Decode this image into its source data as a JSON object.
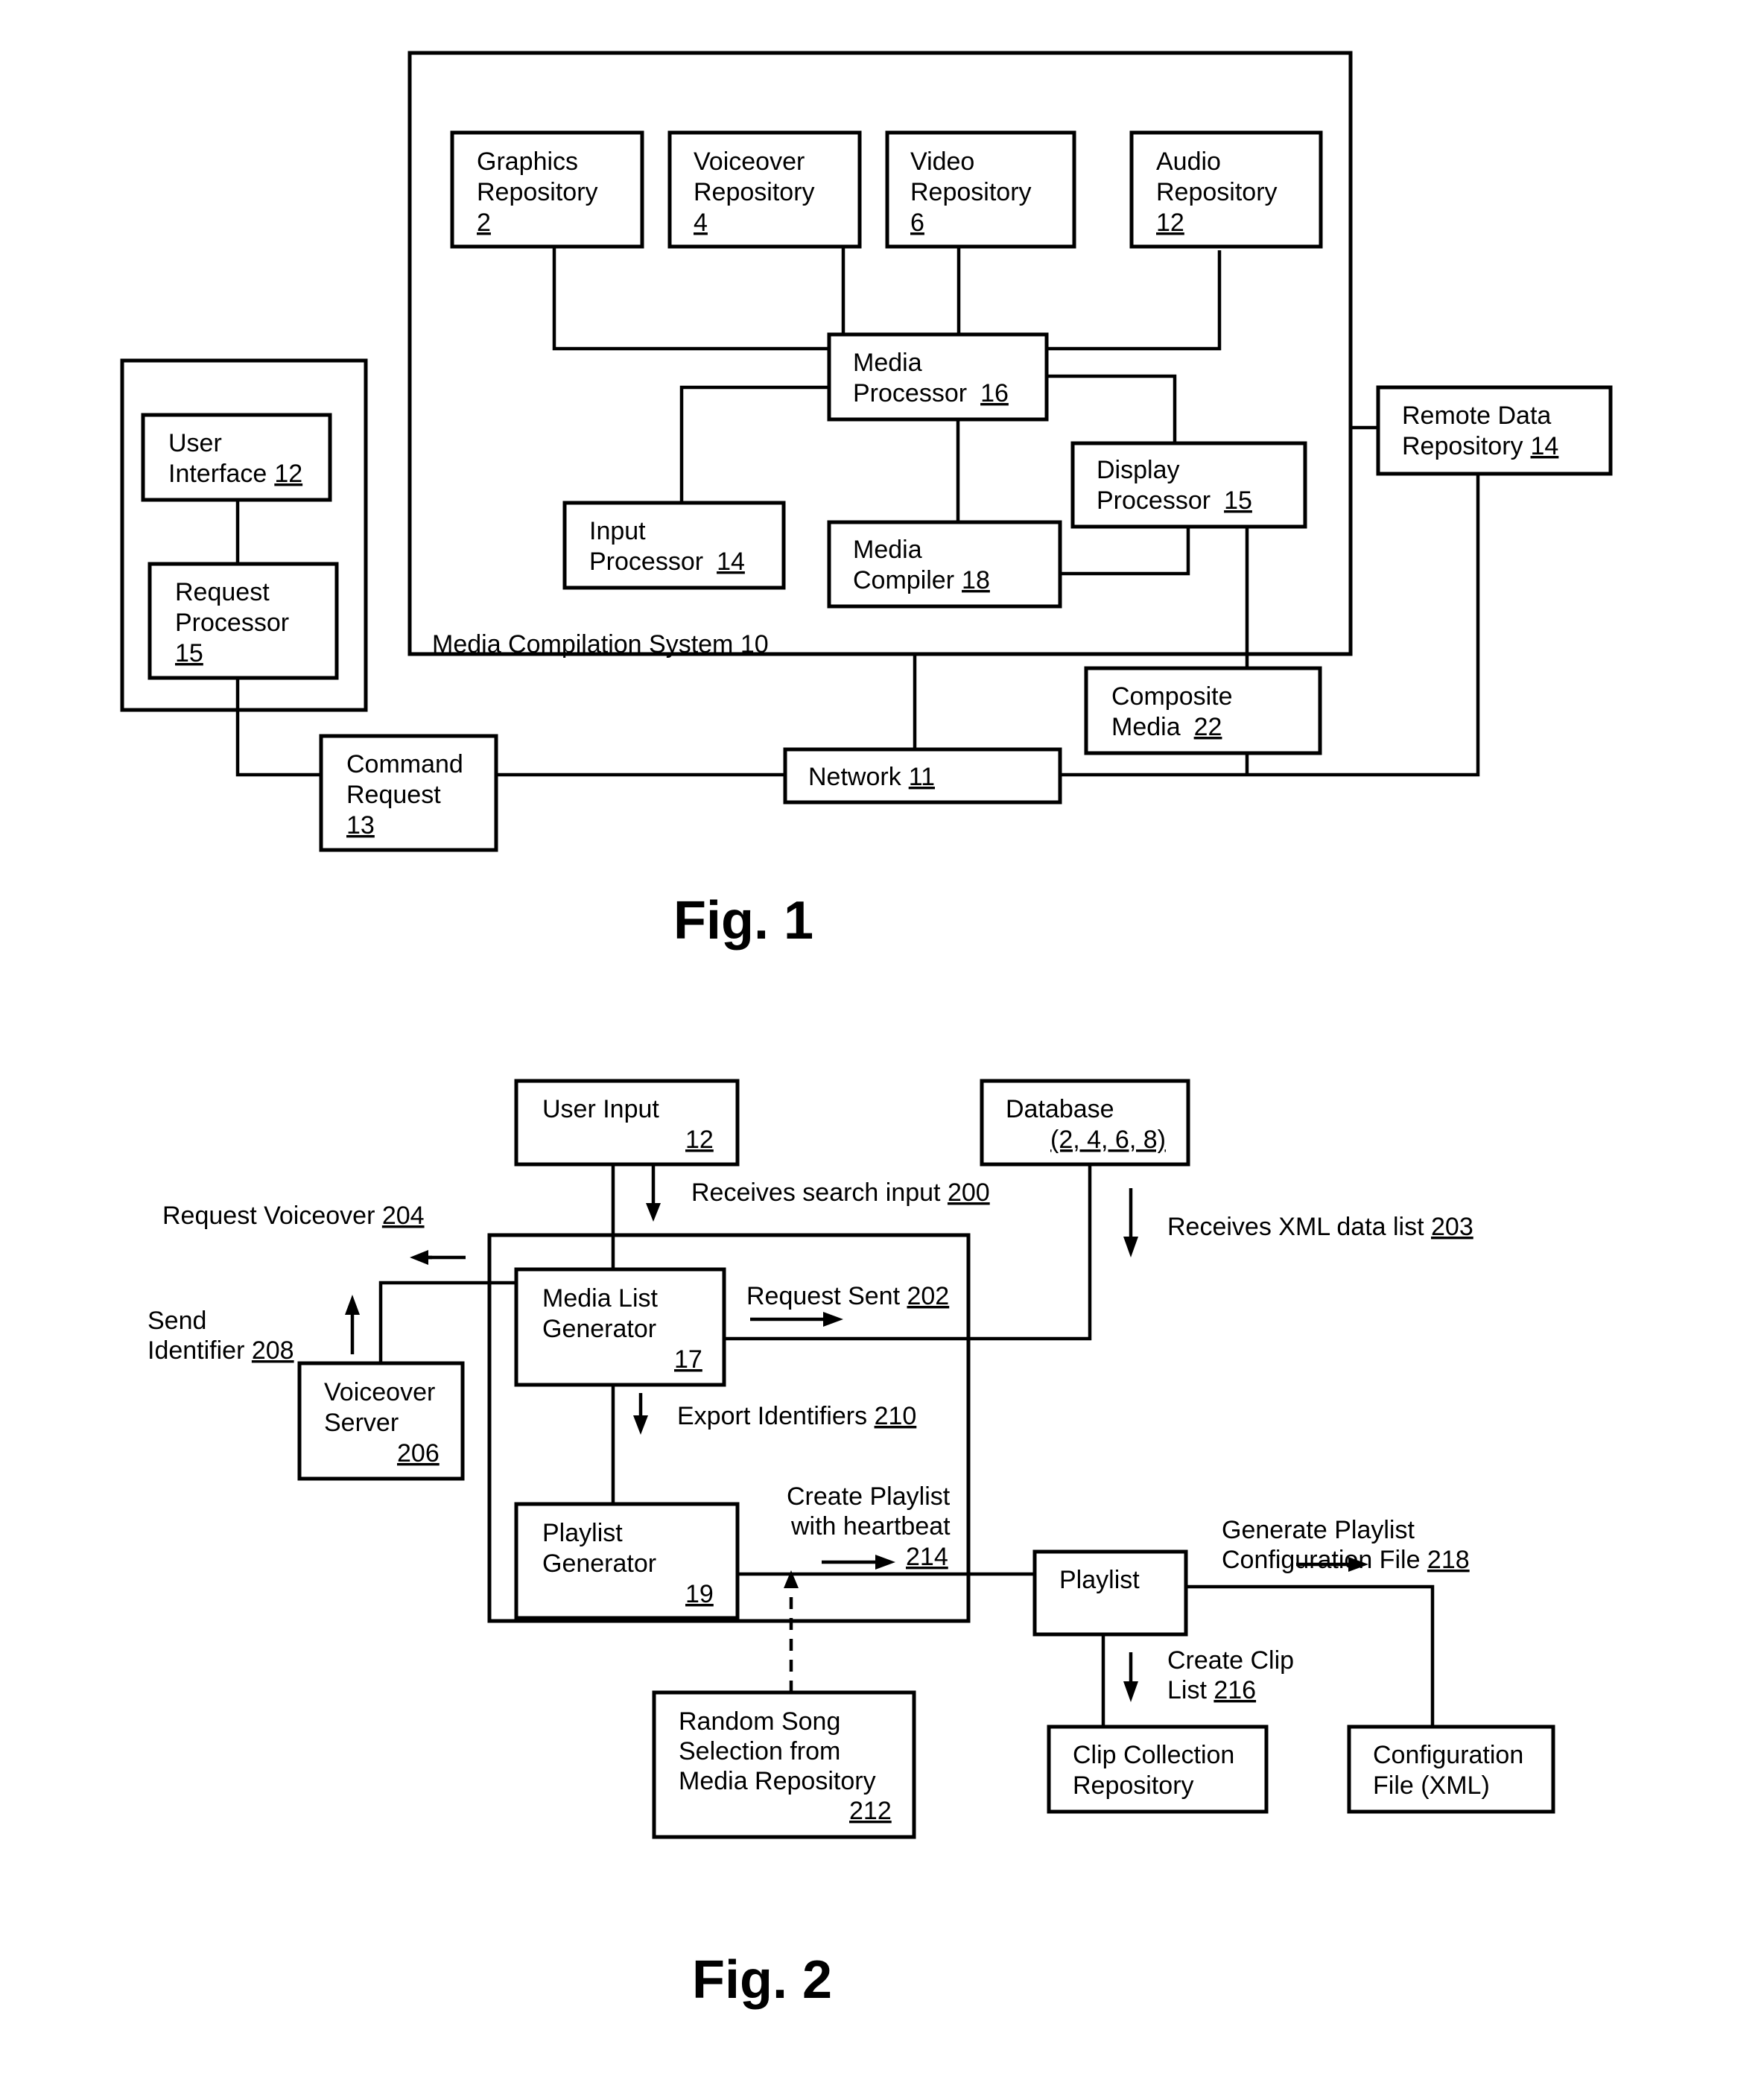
{
  "fig1": {
    "caption": "Fig. 1",
    "system_label": "Media Compilation System 10",
    "graphics_repository": {
      "line1": "Graphics",
      "line2": "Repository",
      "ref": "2"
    },
    "voiceover_repository": {
      "line1": "Voiceover",
      "line2": "Repository",
      "ref": "4"
    },
    "video_repository": {
      "line1": "Video",
      "line2": "Repository",
      "ref": "6"
    },
    "audio_repository": {
      "line1": "Audio",
      "line2": "Repository",
      "ref": "12"
    },
    "media_processor": {
      "line1": "Media",
      "line2": "Processor",
      "ref": "16"
    },
    "input_processor": {
      "line1": "Input",
      "line2": "Processor",
      "ref": "14"
    },
    "media_compiler": {
      "line1": "Media",
      "line2": "Compiler",
      "ref": "18"
    },
    "display_processor": {
      "line1": "Display",
      "line2": "Processor",
      "ref": "15"
    },
    "remote_data_repository": {
      "line1": "Remote Data",
      "line2": "Repository",
      "ref": "14"
    },
    "user_interface": {
      "line1": "User",
      "line2": "Interface",
      "ref": "12"
    },
    "request_processor": {
      "line1": "Request",
      "line2": "Processor",
      "ref": "15"
    },
    "composite_media": {
      "line1": "Composite",
      "line2": "Media",
      "ref": "22"
    },
    "network": {
      "line1": "Network",
      "ref": "11"
    },
    "command_request": {
      "line1": "Command",
      "line2": "Request",
      "ref": "13"
    }
  },
  "fig2": {
    "caption": "Fig. 2",
    "user_input": {
      "line1": "User Input",
      "ref": "12"
    },
    "database": {
      "line1": "Database",
      "ref": "(2, 4, 6, 8)"
    },
    "media_list_generator": {
      "line1": "Media List",
      "line2": "Generator",
      "ref": "17"
    },
    "voiceover_server": {
      "line1": "Voiceover",
      "line2": "Server",
      "ref": "206"
    },
    "playlist_generator": {
      "line1": "Playlist",
      "line2": "Generator",
      "ref": "19"
    },
    "playlist": {
      "line1": "Playlist"
    },
    "random_song": {
      "line1": "Random Song",
      "line2": "Selection from",
      "line3": "Media Repository",
      "ref": "212"
    },
    "clip_collection": {
      "line1": "Clip Collection",
      "line2": "Repository"
    },
    "configuration_file": {
      "line1": "Configuration",
      "line2": "File (XML)"
    },
    "labels": {
      "receives_search_input": {
        "text": "Receives search input ",
        "ref": "200"
      },
      "request_sent": {
        "text": "Request Sent ",
        "ref": "202"
      },
      "receives_xml": {
        "text": "Receives XML data list ",
        "ref": "203"
      },
      "request_voiceover": {
        "text": "Request Voiceover ",
        "ref": "204"
      },
      "send_identifier": {
        "line1": "Send",
        "line2": "Identifier ",
        "ref": "208"
      },
      "export_identifiers": {
        "text": "Export Identifiers ",
        "ref": "210"
      },
      "create_playlist": {
        "line1": "Create Playlist",
        "line2": "with heartbeat",
        "ref": "214"
      },
      "create_clip_list": {
        "line1": "Create Clip",
        "line2": "List ",
        "ref": "216"
      },
      "generate_config": {
        "line1": "Generate Playlist",
        "line2": "Configuration File ",
        "ref": "218"
      }
    }
  }
}
